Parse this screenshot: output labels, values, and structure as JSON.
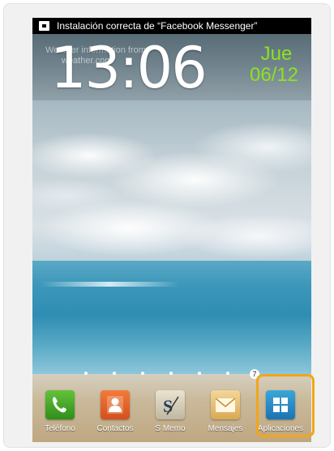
{
  "status_bar": {
    "notification_icon": "download-complete-icon",
    "notification_text": "Instalación correcta de “Facebook Messenger”"
  },
  "clock_widget": {
    "weather_line1": "Weather information from",
    "weather_line2": "weather.com",
    "time": "13:06",
    "day": "Jue",
    "date": "06/12",
    "accent_color": "#8be41c"
  },
  "page_indicator": {
    "page_count": 7,
    "current_page_badge": "7"
  },
  "dock": {
    "items": [
      {
        "label": "Teléfono",
        "icon": "phone-icon"
      },
      {
        "label": "Contactos",
        "icon": "contacts-icon"
      },
      {
        "label": "S Memo",
        "icon": "s-memo-icon"
      },
      {
        "label": "Mensajes",
        "icon": "messages-icon"
      },
      {
        "label": "Aplicaciones",
        "icon": "apps-grid-icon"
      }
    ]
  },
  "highlight_color": "#f2a618"
}
